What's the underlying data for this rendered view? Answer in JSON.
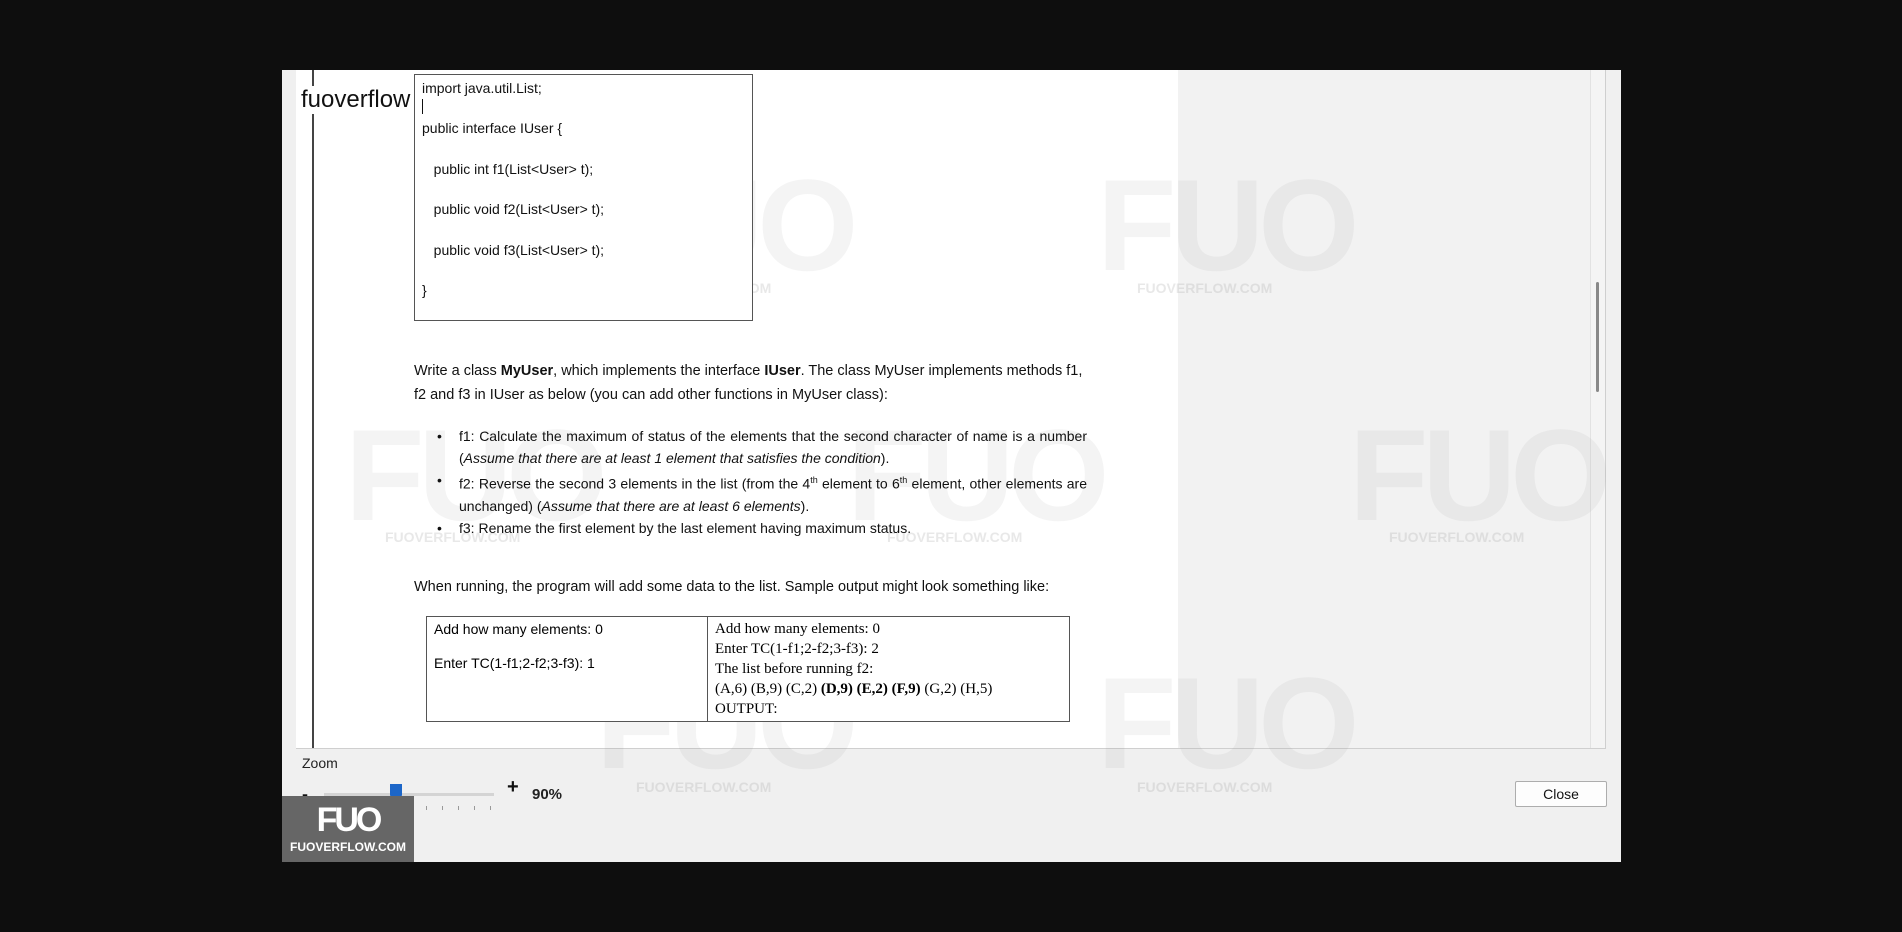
{
  "brand_label": "fuoverflow",
  "code_lines": [
    "import java.util.List;",
    "public interface IUser {",
    "   public int f1(List<User> t);",
    "   public void f2(List<User> t);",
    "   public void f3(List<User> t);",
    "}"
  ],
  "intro": {
    "p1": "Write a class ",
    "b1": "MyUser",
    "p2": ", which implements the interface ",
    "b2": "IUser",
    "p3": ". The class MyUser implements methods  f1,",
    "line2": "f2 and f3 in IUser as below (you can add other functions in MyUser class):"
  },
  "bullets": {
    "f1_text": "f1: Calculate the maximum of status of the elements that the second character of name is a number (",
    "f1_italic": "Assume that there are at least 1 element that satisfies the condition",
    "f1_end": ").",
    "f2_a": "f2: Reverse the second 3 elements in the list (from the 4",
    "f2_sup1": "th",
    "f2_b": " element to 6",
    "f2_sup2": "th",
    "f2_c": " element, other elements are unchanged) (",
    "f2_italic": "Assume that there are at least 6 elements",
    "f2_end": ").",
    "f3_text": "f3: Rename the first element by the last element having maximum status."
  },
  "running_text": "When running, the program will add  some data to the list. Sample output might look something like:",
  "sample": {
    "left_line1": "Add how many elements: 0",
    "left_line2": "Enter TC(1-f1;2-f2;3-f3): 1",
    "right_line1": "Add how many elements: 0",
    "right_line2": "Enter TC(1-f1;2-f2;3-f3): 2",
    "right_line3": "The list before running f2:",
    "right_line4_a": "(A,6) (B,9) (C,2) ",
    "right_line4_bold": "(D,9) (E,2) (F,9)",
    "right_line4_b": " (G,2) (H,5)",
    "right_line5": "OUTPUT:"
  },
  "watermark": {
    "mark": "FUO",
    "site": "FUOVERFLOW.COM"
  },
  "zoom": {
    "label": "Zoom",
    "minus": "-",
    "plus": "+",
    "value": "90%",
    "level_percent": 90
  },
  "close_label": "Close",
  "logo": {
    "mark": "FUO",
    "text": "FUOVERFLOW.COM"
  }
}
